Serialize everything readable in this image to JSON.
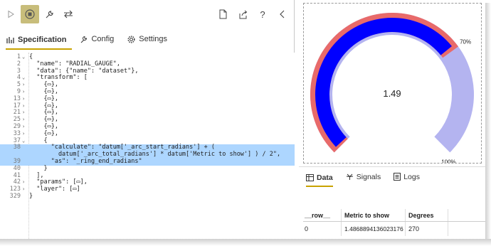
{
  "toolbar": {
    "left_icons": [
      "play-icon",
      "stop-icon",
      "wrench-icon",
      "swap-icon"
    ],
    "right_icons": [
      "document-icon",
      "share-icon",
      "help-icon",
      "back-icon"
    ],
    "help_label": "?"
  },
  "tabs": [
    {
      "label": "Specification",
      "icon": "spec-icon"
    },
    {
      "label": "Config",
      "icon": "config-icon"
    },
    {
      "label": "Settings",
      "icon": "gear-icon"
    }
  ],
  "editor": {
    "lines": [
      {
        "n": "1",
        "fold": "v",
        "code": "{"
      },
      {
        "n": "2",
        "fold": "",
        "code": "  \"name\": \"RADIAL_GAUGE\","
      },
      {
        "n": "3",
        "fold": "",
        "code": "  \"data\": {\"name\": \"dataset\"},"
      },
      {
        "n": "4",
        "fold": "v",
        "code": "  \"transform\": ["
      },
      {
        "n": "5",
        "fold": ">",
        "code": "    {▭},"
      },
      {
        "n": "9",
        "fold": ">",
        "code": "    {▭},"
      },
      {
        "n": "13",
        "fold": ">",
        "code": "    {▭},"
      },
      {
        "n": "17",
        "fold": ">",
        "code": "    {▭},"
      },
      {
        "n": "21",
        "fold": ">",
        "code": "    {▭},"
      },
      {
        "n": "25",
        "fold": ">",
        "code": "    {▭},"
      },
      {
        "n": "29",
        "fold": ">",
        "code": "    {▭},"
      },
      {
        "n": "33",
        "fold": ">",
        "code": "    {▭},"
      },
      {
        "n": "37",
        "fold": "v",
        "code": "    {"
      },
      {
        "n": "38",
        "fold": "",
        "code": "      \"calculate\": \"datum['_arc_start_radians'] + ("
      },
      {
        "n": "",
        "fold": "",
        "code": "        datum['_arc_total_radians'] * datum['Metric to show'] ) / 2\","
      },
      {
        "n": "39",
        "fold": "",
        "code": "      \"as\": \"_ring_end_radians\""
      },
      {
        "n": "40",
        "fold": "",
        "code": "    }"
      },
      {
        "n": "41",
        "fold": "",
        "code": "  ],"
      },
      {
        "n": "42",
        "fold": ">",
        "code": "  \"params\": [▭],"
      },
      {
        "n": "123",
        "fold": ">",
        "code": "  \"layer\": [▭]"
      },
      {
        "n": "329",
        "fold": "",
        "code": "}"
      }
    ]
  },
  "gauge": {
    "center_value": "1.49",
    "label_top": "70%",
    "label_end": "100%",
    "colors": {
      "background_ring": "#b4b4f0",
      "outer_ring": "#e86a6a",
      "inner_ring": "#0000ff"
    },
    "outer_fraction": 0.7,
    "inner_fraction": 0.7
  },
  "bottom_tabs": [
    {
      "label": "Data",
      "icon": "table-icon"
    },
    {
      "label": "Signals",
      "icon": "signals-icon"
    },
    {
      "label": "Logs",
      "icon": "logs-icon"
    }
  ],
  "table": {
    "headers": [
      "__row__",
      "Metric to show",
      "Degrees",
      ""
    ],
    "rows": [
      [
        "0",
        "1.4868894136023176",
        "270",
        ""
      ]
    ]
  }
}
